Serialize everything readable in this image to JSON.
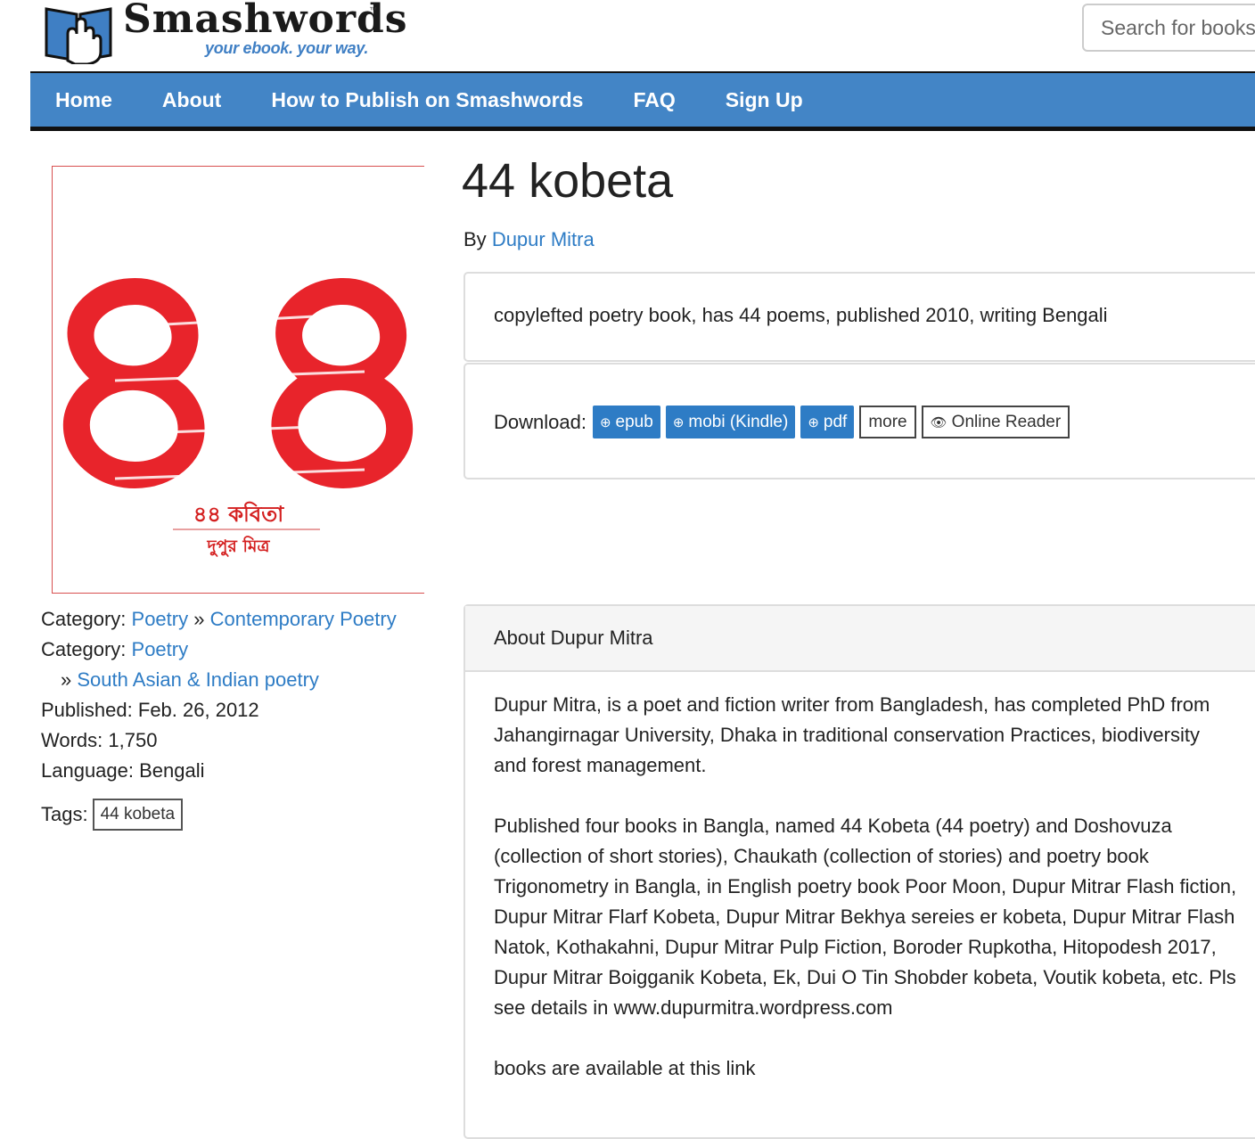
{
  "header": {
    "logo_text": "Smashwords",
    "logo_tm": "™",
    "tagline": "your ebook. your way.",
    "search_placeholder": "Search for books"
  },
  "nav": {
    "items": [
      "Home",
      "About",
      "How to Publish on Smashwords",
      "FAQ",
      "Sign Up"
    ]
  },
  "cover": {
    "numeral": "৪৪",
    "title": "৪৪ কবিতা",
    "author": "দুপুর মিত্র",
    "accent_color": "#e8242b"
  },
  "meta": {
    "category_label": "Category:",
    "cat1": [
      "Poetry",
      "Contemporary Poetry"
    ],
    "cat2": [
      "Poetry",
      "South Asian & Indian poetry"
    ],
    "sep": "»",
    "published_label": "Published:",
    "published": "Feb. 26, 2012",
    "words_label": "Words:",
    "words": "1,750",
    "language_label": "Language:",
    "language": "Bengali",
    "tags_label": "Tags:",
    "tags": [
      "44 kobeta"
    ]
  },
  "book": {
    "title": "44 kobeta",
    "by_label": "By",
    "author": "Dupur Mitra",
    "description": "copylefted poetry book, has 44 poems, published 2010, writing Bengali"
  },
  "download": {
    "label": "Download:",
    "epub": "epub",
    "mobi": "mobi (Kindle)",
    "pdf": "pdf",
    "more": "more",
    "reader": "Online Reader",
    "button_color": "#2e7cc5"
  },
  "about": {
    "heading": "About Dupur Mitra",
    "p1": "Dupur Mitra, is a poet and fiction writer from Bangladesh, has completed PhD from Jahangirnagar University, Dhaka in traditional conservation Practices, biodiversity and forest management.",
    "p2": "Published four books in Bangla, named 44 Kobeta (44 poetry) and Doshovuza (collection of short stories), Chaukath (collection of stories) and poetry book Trigonometry in Bangla, in English poetry book Poor Moon, Dupur Mitrar Flash fiction, Dupur Mitrar Flarf Kobeta, Dupur Mitrar Bekhya sereies er kobeta, Dupur Mitrar Flash Natok, Kothakahni, Dupur Mitrar Pulp Fiction, Boroder Rupkotha, Hitopodesh 2017, Dupur Mitrar Boigganik Kobeta, Ek, Dui O Tin Shobder kobeta, Voutik kobeta, etc. Pls see details in www.dupurmitra.wordpress.com",
    "p3": "books are available at this link"
  }
}
